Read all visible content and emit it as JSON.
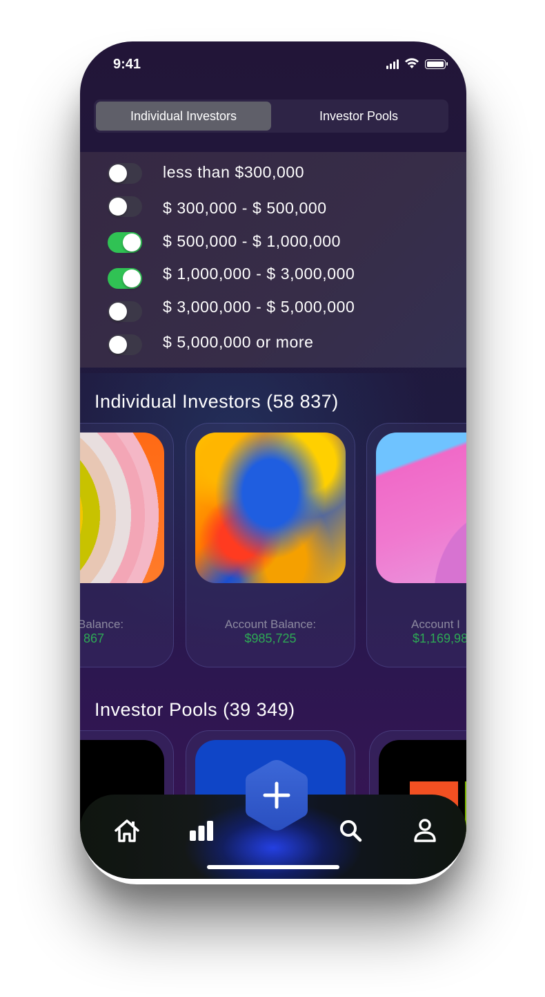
{
  "status_bar": {
    "time": "9:41"
  },
  "segmented": {
    "tabs": [
      {
        "label": "Individual Investors",
        "active": true
      },
      {
        "label": "Investor Pools",
        "active": false
      }
    ]
  },
  "filters": [
    {
      "label": "less than $300,000",
      "on": false
    },
    {
      "label": "$ 300,000 - $ 500,000",
      "on": false
    },
    {
      "label": "$ 500,000 - $ 1,000,000",
      "on": true
    },
    {
      "label": "$ 1,000,000 - $ 3,000,000",
      "on": true
    },
    {
      "label": "$ 3,000,000 - $ 5,000,000",
      "on": false
    },
    {
      "label": "$ 5,000,000 or more",
      "on": false
    }
  ],
  "individual_investors": {
    "title": "Individual Investors (58 837)",
    "cards": [
      {
        "label": "Balance:",
        "value": "867"
      },
      {
        "label": "Account Balance:",
        "value": "$985,725"
      },
      {
        "label": "Account I",
        "value": "$1,169,98"
      }
    ]
  },
  "investor_pools": {
    "title": "Investor Pools (39 349)"
  },
  "tabbar": {
    "items": [
      "home-icon",
      "chart-icon",
      "add-icon",
      "search-icon",
      "profile-icon"
    ]
  },
  "colors": {
    "toggle_on": "#30c254",
    "balance_value": "#2eaa55",
    "accent_blue": "#2d52c8"
  }
}
